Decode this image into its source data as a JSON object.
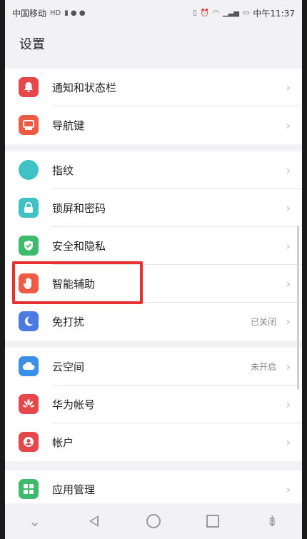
{
  "status_bar": {
    "carrier": "中国移动",
    "hd": "HD",
    "time": "中午11:37"
  },
  "page": {
    "title": "设置"
  },
  "groups": [
    {
      "items": [
        {
          "label": "通知和状态栏",
          "icon": "bell-icon",
          "color": "#e5474a"
        },
        {
          "label": "导航键",
          "icon": "navigation-key-icon",
          "color": "#ef5a42"
        }
      ]
    },
    {
      "items": [
        {
          "label": "指纹",
          "icon": "fingerprint-icon",
          "color": "#3fc2c6"
        },
        {
          "label": "锁屏和密码",
          "icon": "lock-icon",
          "color": "#3fc2c6"
        },
        {
          "label": "安全和隐私",
          "icon": "shield-icon",
          "color": "#3dba6c"
        },
        {
          "label": "智能辅助",
          "icon": "hand-icon",
          "color": "#ef5a42"
        },
        {
          "label": "免打扰",
          "value": "已关闭",
          "icon": "moon-icon",
          "color": "#4a7be3"
        }
      ]
    },
    {
      "items": [
        {
          "label": "云空间",
          "value": "未开启",
          "icon": "cloud-icon",
          "color": "#3a8fe8"
        },
        {
          "label": "华为帐号",
          "icon": "huawei-icon",
          "color": "#e5474a"
        },
        {
          "label": "帐户",
          "icon": "account-icon",
          "color": "#e5474a"
        }
      ]
    },
    {
      "items": [
        {
          "label": "应用管理",
          "icon": "apps-icon",
          "color": "#3dba6c"
        }
      ]
    }
  ],
  "highlight_color": "#e5312f"
}
